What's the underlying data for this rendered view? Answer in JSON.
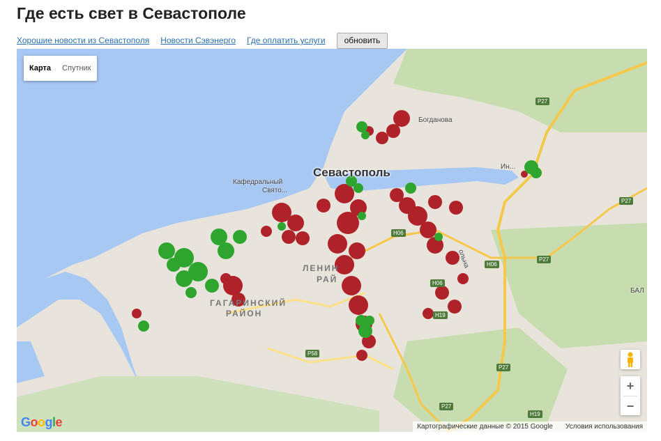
{
  "page": {
    "title": "Где есть свет в Севастополе"
  },
  "links": {
    "good_news": "Хорошие новости из Севастополя",
    "sevenergo_news": "Новости Сэвэнерго",
    "pay_services": "Где оплатить услуги",
    "refresh_label": "обновить"
  },
  "map": {
    "type_map": "Карта",
    "type_satellite": "Спутник",
    "zoom_in": "+",
    "zoom_out": "−",
    "labels": {
      "city": "Севастополь",
      "cathedral": "Кафедральный",
      "cathedral2": "Свято...",
      "bogdanova": "Богданова",
      "inkerman": "Ин...",
      "leninsky1": "ЛЕНИН",
      "leninsky2": "РАЙ",
      "gagarinsky1": "ГАГАРИНСКИЙ",
      "gagarinsky2": "РАЙОН",
      "bal": "БАЛ",
      "olimp": "ольна"
    },
    "roads": {
      "p27": "P27",
      "h06": "H06",
      "h19": "H19",
      "p58": "P58"
    },
    "footer_data": "Картографические данные © 2015 Google",
    "footer_terms": "Условия использования",
    "colors": {
      "powered": "#2ea52e",
      "no_power": "#b0222a",
      "water": "#a7c8f2",
      "land": "#e8e4dc",
      "green_area": "#c7ddb0",
      "highway": "#f5c84c"
    }
  }
}
